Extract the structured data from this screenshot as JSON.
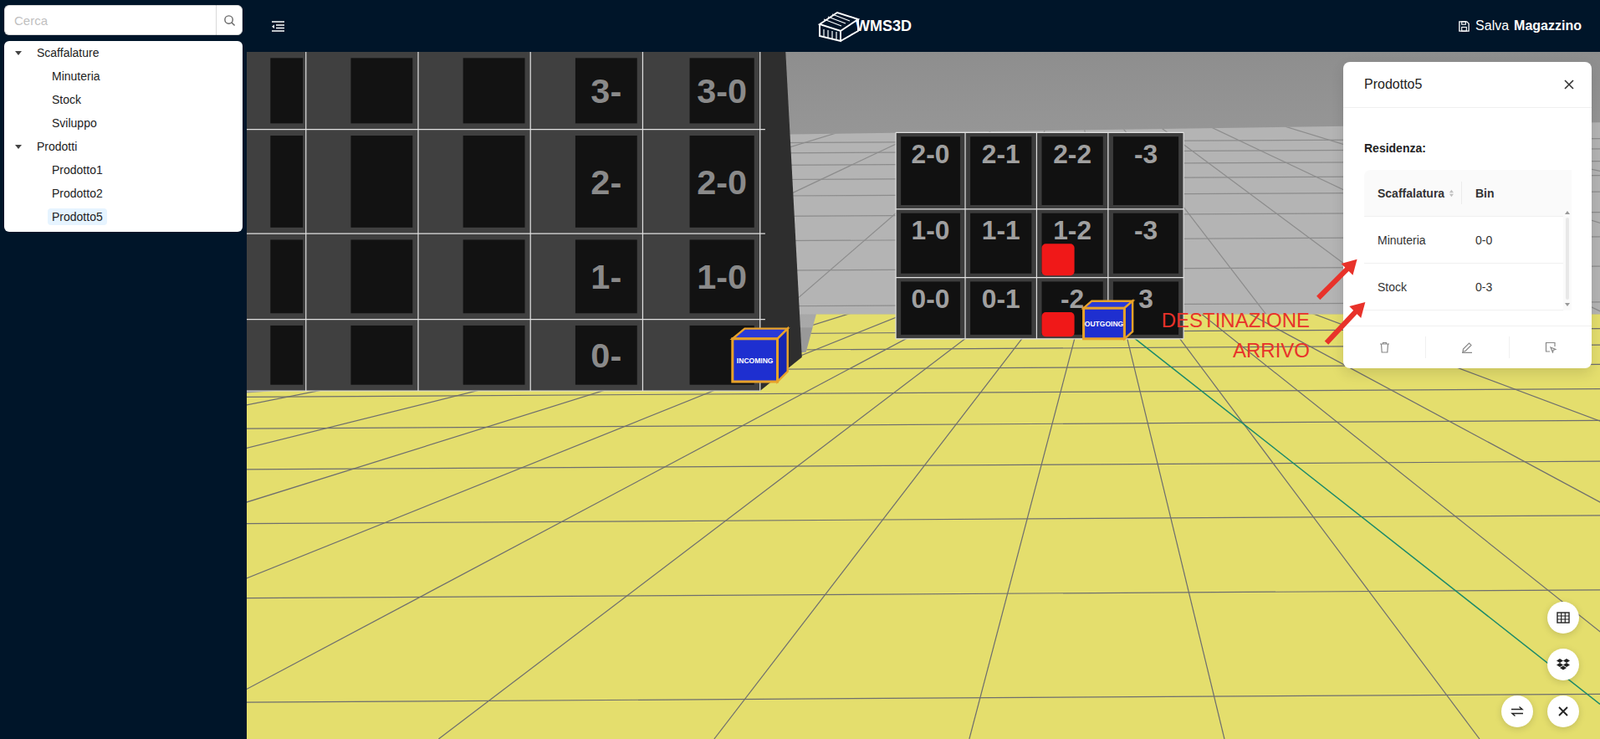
{
  "search": {
    "placeholder": "Cerca"
  },
  "tree": [
    {
      "label": "Scaffalature",
      "expanded": true,
      "children": [
        {
          "label": "Minuteria",
          "selected": false
        },
        {
          "label": "Stock",
          "selected": false
        },
        {
          "label": "Sviluppo",
          "selected": false
        }
      ]
    },
    {
      "label": "Prodotti",
      "expanded": true,
      "children": [
        {
          "label": "Prodotto1",
          "selected": false
        },
        {
          "label": "Prodotto2",
          "selected": false
        },
        {
          "label": "Prodotto5",
          "selected": true
        }
      ]
    }
  ],
  "header": {
    "logo": "WMS3D",
    "save_label": "Salva",
    "save_target": "Magazzino"
  },
  "scene": {
    "left_rack": {
      "labels": [
        "3-",
        "3-0",
        "2-",
        "2-0",
        "1-",
        "1-0",
        "0-"
      ]
    },
    "right_rack": {
      "rows": [
        [
          {
            "label": "2-0",
            "has_product": false
          },
          {
            "label": "2-1",
            "has_product": false
          },
          {
            "label": "2-2",
            "has_product": false
          },
          {
            "label": "-3",
            "has_product": false
          }
        ],
        [
          {
            "label": "1-0",
            "has_product": false
          },
          {
            "label": "1-1",
            "has_product": false
          },
          {
            "label": "1-2",
            "has_product": true
          },
          {
            "label": "-3",
            "has_product": false
          }
        ],
        [
          {
            "label": "0-0",
            "has_product": false
          },
          {
            "label": "0-1",
            "has_product": false
          },
          {
            "label": "-2",
            "has_product": true
          },
          {
            "label": "3",
            "has_product": false
          }
        ]
      ]
    },
    "incoming_box": "INCOMING",
    "outgoing_box": "OUTGOING"
  },
  "annotation": [
    "DESTINAZIONE",
    "ARRIVO"
  ],
  "detail": {
    "title": "Prodotto5",
    "section": "Residenza:",
    "columns": [
      "Scaffalatura",
      "Bin"
    ],
    "rows": [
      {
        "rack": "Minuteria",
        "bin": "0-0"
      },
      {
        "rack": "Stock",
        "bin": "0-3"
      }
    ]
  }
}
